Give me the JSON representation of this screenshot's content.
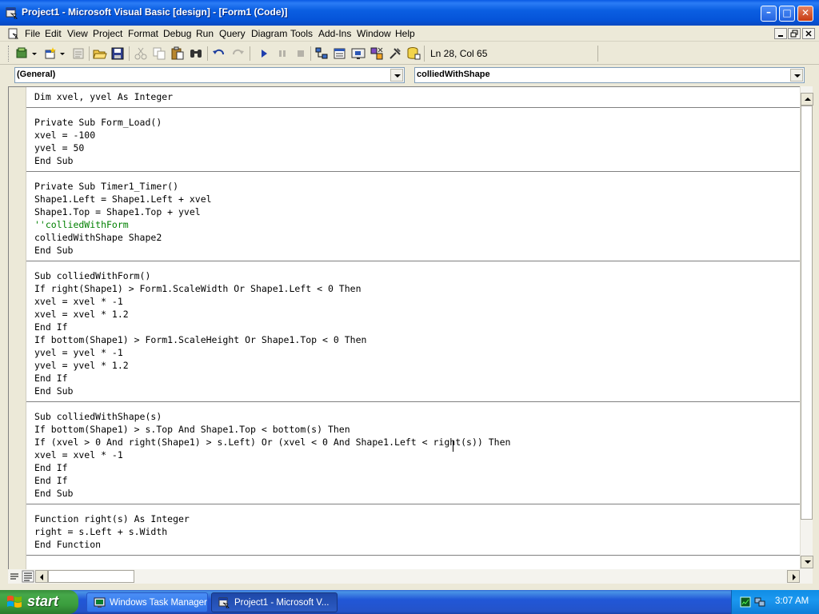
{
  "window": {
    "title": "Project1 - Microsoft Visual Basic [design] - [Form1 (Code)]",
    "minimize_glyph": "–",
    "maximize_glyph": "□",
    "close_glyph": "✕"
  },
  "menu": {
    "items": [
      "File",
      "Edit",
      "View",
      "Project",
      "Format",
      "Debug",
      "Run",
      "Query",
      "Diagram",
      "Tools",
      "Add-Ins",
      "Window",
      "Help"
    ]
  },
  "toolbar": {
    "position_status": "Ln 28, Col 65"
  },
  "editor": {
    "object_combo": "(General)",
    "procedure_combo": "colliedWithShape",
    "lines": [
      {
        "text": "Dim xvel, yvel As Integer",
        "kind": "code"
      },
      {
        "text": "",
        "kind": "sep"
      },
      {
        "text": "Private Sub Form_Load()",
        "kind": "code"
      },
      {
        "text": "xvel = -100",
        "kind": "code"
      },
      {
        "text": "yvel = 50",
        "kind": "code"
      },
      {
        "text": "End Sub",
        "kind": "code"
      },
      {
        "text": "",
        "kind": "sep"
      },
      {
        "text": "Private Sub Timer1_Timer()",
        "kind": "code"
      },
      {
        "text": "Shape1.Left = Shape1.Left + xvel",
        "kind": "code"
      },
      {
        "text": "Shape1.Top = Shape1.Top + yvel",
        "kind": "code"
      },
      {
        "text": "''colliedWithForm",
        "kind": "comment"
      },
      {
        "text": "colliedWithShape Shape2",
        "kind": "code"
      },
      {
        "text": "End Sub",
        "kind": "code"
      },
      {
        "text": "",
        "kind": "sep"
      },
      {
        "text": "Sub colliedWithForm()",
        "kind": "code"
      },
      {
        "text": "If right(Shape1) > Form1.ScaleWidth Or Shape1.Left < 0 Then",
        "kind": "code"
      },
      {
        "text": "xvel = xvel * -1",
        "kind": "code"
      },
      {
        "text": "xvel = xvel * 1.2",
        "kind": "code"
      },
      {
        "text": "End If",
        "kind": "code"
      },
      {
        "text": "If bottom(Shape1) > Form1.ScaleHeight Or Shape1.Top < 0 Then",
        "kind": "code"
      },
      {
        "text": "yvel = yvel * -1",
        "kind": "code"
      },
      {
        "text": "yvel = yvel * 1.2",
        "kind": "code"
      },
      {
        "text": "End If",
        "kind": "code"
      },
      {
        "text": "End Sub",
        "kind": "code"
      },
      {
        "text": "",
        "kind": "sep"
      },
      {
        "text": "Sub colliedWithShape(s)",
        "kind": "code"
      },
      {
        "text": "If bottom(Shape1) > s.Top And Shape1.Top < bottom(s) Then",
        "kind": "code"
      },
      {
        "text": "If (xvel > 0 And right(Shape1) > s.Left) Or (xvel < 0 And Shape1.Left < right(s)) Then",
        "kind": "code"
      },
      {
        "text": "xvel = xvel * -1",
        "kind": "code"
      },
      {
        "text": "End If",
        "kind": "code"
      },
      {
        "text": "End If",
        "kind": "code"
      },
      {
        "text": "End Sub",
        "kind": "code"
      },
      {
        "text": "",
        "kind": "sep"
      },
      {
        "text": "Function right(s) As Integer",
        "kind": "code"
      },
      {
        "text": "right = s.Left + s.Width",
        "kind": "code"
      },
      {
        "text": "End Function",
        "kind": "code"
      },
      {
        "text": "",
        "kind": "sep"
      }
    ]
  },
  "taskbar": {
    "start_label": "start",
    "tasks": [
      {
        "label": "Windows Task Manager",
        "active": false
      },
      {
        "label": "Project1 - Microsoft V...",
        "active": true
      }
    ],
    "clock": "3:07 AM"
  },
  "colors": {
    "comment": "#008000",
    "titlebar": "#0a5ae4",
    "taskbar": "#2453c9"
  }
}
